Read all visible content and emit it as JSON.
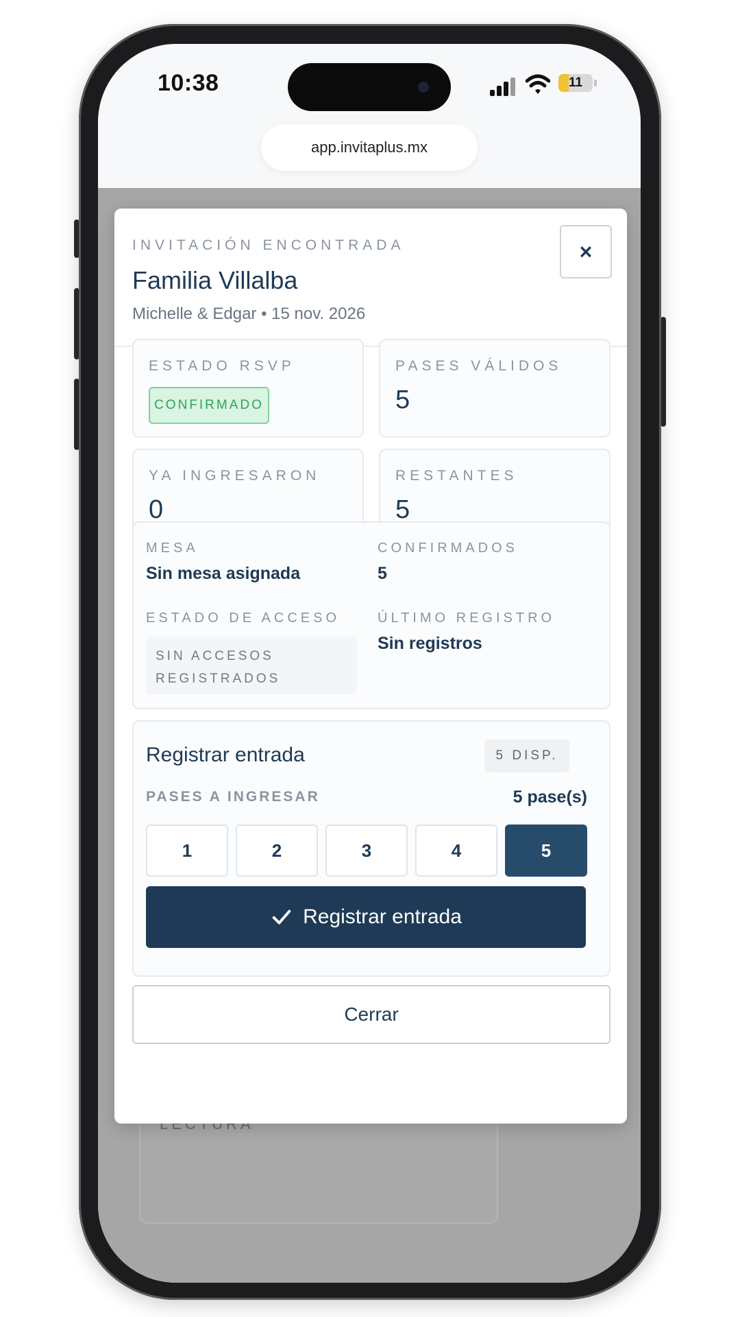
{
  "status_bar": {
    "time": "10:38",
    "battery": "11"
  },
  "browser": {
    "url": "app.invitaplus.mx"
  },
  "background": {
    "section_label": "LECTURA"
  },
  "modal": {
    "kicker": "INVITACIÓN ENCONTRADA",
    "title": "Familia Villalba",
    "subtitle": "Michelle & Edgar • 15 nov. 2026",
    "close_symbol": "×",
    "stats": {
      "rsvp_label": "ESTADO RSVP",
      "rsvp_value": "CONFIRMADO",
      "valid_label": "PASES VÁLIDOS",
      "valid_value": "5",
      "entered_label": "YA INGRESARON",
      "entered_value": "0",
      "remaining_label": "RESTANTES",
      "remaining_value": "5"
    },
    "info": {
      "table_label": "MESA",
      "table_value": "Sin mesa asignada",
      "confirmed_label": "CONFIRMADOS",
      "confirmed_value": "5",
      "access_label": "ESTADO DE ACCESO",
      "access_value": "SIN ACCESOS REGISTRADOS",
      "last_label": "ÚLTIMO REGISTRO",
      "last_value": "Sin registros"
    },
    "register": {
      "title": "Registrar entrada",
      "available": "5 DISP.",
      "passes_label": "PASES A INGRESAR",
      "passes_selected": "5 pase(s)",
      "options": [
        "1",
        "2",
        "3",
        "4",
        "5"
      ],
      "selected_index": 4,
      "submit_label": "Registrar entrada"
    },
    "close_label": "Cerrar"
  },
  "colors": {
    "primary": "#1e3a56",
    "selected_pass": "#274b6b",
    "confirmed_badge": "#2fa35b"
  }
}
